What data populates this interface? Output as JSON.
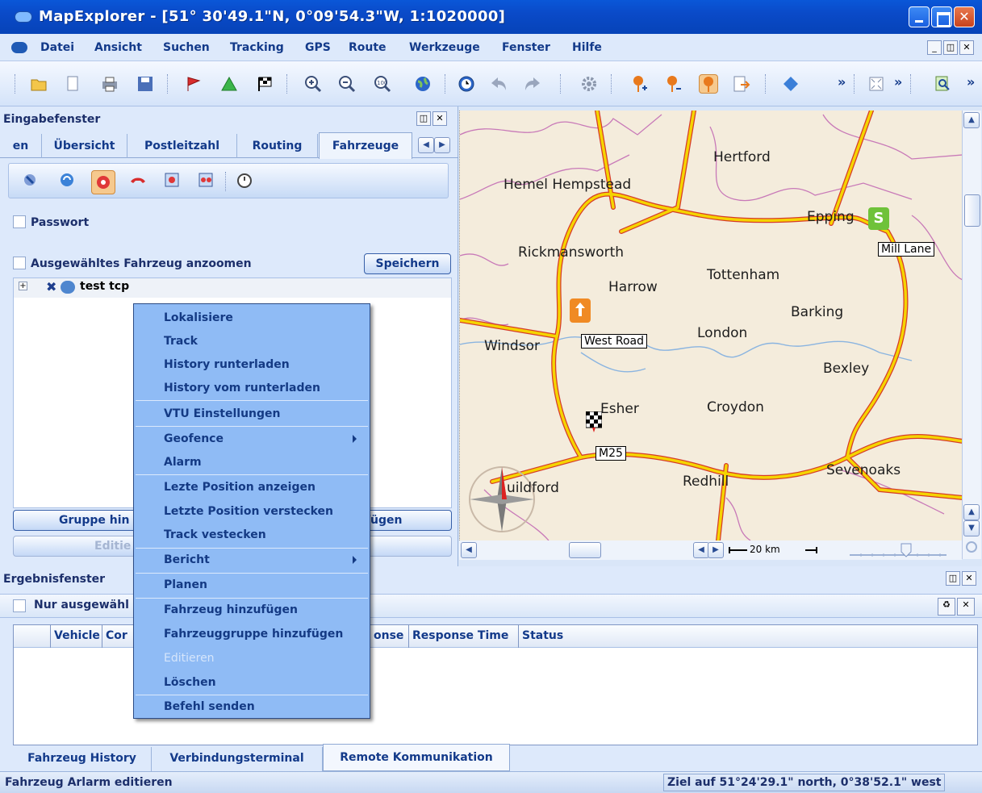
{
  "window": {
    "title": "MapExplorer - [51° 30'49.1\"N, 0°09'54.3\"W, 1:1020000]"
  },
  "menubar": {
    "items": [
      "Datei",
      "Ansicht",
      "Suchen",
      "Tracking",
      "GPS",
      "Route",
      "Werkzeuge",
      "Fenster",
      "Hilfe"
    ]
  },
  "toolbar": {
    "overflow": "»"
  },
  "input_panel": {
    "title": "Eingabefenster",
    "tabs": [
      "en",
      "Übersicht",
      "Postleitzahl",
      "Routing",
      "Fahrzeuge"
    ],
    "active_tab": "Fahrzeuge",
    "password_label": "Passwort",
    "zoom_label": "Ausgewähltes Fahrzeug anzoomen",
    "save_button": "Speichern",
    "tree_root": "test tcp",
    "add_group_button": "Gruppe hin",
    "add_button_tail": "ufügen",
    "edit_button": "Editie"
  },
  "map": {
    "places": [
      "Hertford",
      "Hemel Hempstead",
      "Epping",
      "Rickmansworth",
      "Tottenham",
      "Harrow",
      "Barking",
      "London",
      "Windsor",
      "Bexley",
      "Esher",
      "Croydon",
      "Redhill",
      "Sevenoaks",
      "uildford"
    ],
    "markers": {
      "start_letter": "S",
      "start_label": "Mill Lane",
      "waypoint_label": "West Road",
      "road_label": "M25"
    },
    "scale": "20 km"
  },
  "context_menu": {
    "items": [
      {
        "label": "Lokalisiere",
        "submenu": false,
        "enabled": true
      },
      {
        "label": "Track",
        "submenu": false,
        "enabled": true
      },
      {
        "label": "History runterladen",
        "submenu": false,
        "enabled": true
      },
      {
        "label": "History vom runterladen",
        "submenu": false,
        "enabled": true
      },
      {
        "label": "VTU Einstellungen",
        "submenu": false,
        "enabled": true
      },
      {
        "label": "Geofence",
        "submenu": true,
        "enabled": true
      },
      {
        "label": "Alarm",
        "submenu": false,
        "enabled": true
      },
      {
        "label": "Lezte Position anzeigen",
        "submenu": false,
        "enabled": true
      },
      {
        "label": "Letzte Position verstecken",
        "submenu": false,
        "enabled": true
      },
      {
        "label": "Track vestecken",
        "submenu": false,
        "enabled": true
      },
      {
        "label": "Bericht",
        "submenu": true,
        "enabled": true
      },
      {
        "label": "Planen",
        "submenu": false,
        "enabled": true
      },
      {
        "label": "Fahrzeug hinzufügen",
        "submenu": false,
        "enabled": true
      },
      {
        "label": "Fahrzeuggruppe hinzufügen",
        "submenu": false,
        "enabled": true
      },
      {
        "label": "Editieren",
        "submenu": false,
        "enabled": false
      },
      {
        "label": "Löschen",
        "submenu": false,
        "enabled": true
      },
      {
        "label": "Befehl senden",
        "submenu": false,
        "enabled": true
      }
    ]
  },
  "result_panel": {
    "title": "Ergebnisfenster",
    "filter_label": "Nur ausgewähl",
    "columns": [
      "",
      "Vehicle",
      "Cor",
      "onse",
      "Response Time",
      "Status"
    ],
    "tabs": [
      "Fahrzeug History",
      "Verbindungsterminal",
      "Remote Kommunikation"
    ],
    "active_tab": "Remote Kommunikation"
  },
  "statusbar": {
    "left": "Fahrzeug Arlarm editieren",
    "right": "Ziel auf 51°24'29.1\" north, 0°38'52.1\" west"
  },
  "colors": {
    "titlebar": "#0a4ac8",
    "menu_bg": "#8fbbf5",
    "road": "#f5d400",
    "road_outline": "#d63b2a",
    "border_line": "#c879b8",
    "river": "#8ab4e0",
    "map_bg": "#f4ecdc"
  }
}
